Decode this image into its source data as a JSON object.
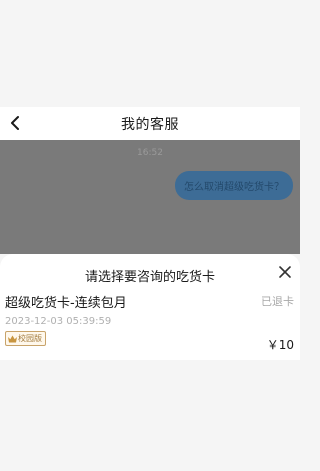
{
  "nav": {
    "title": "我的客服"
  },
  "chat": {
    "time": "16:52",
    "user_message": "怎么取消超级吃货卡？"
  },
  "sheet": {
    "title": "请选择要咨询的吃货卡",
    "card": {
      "name": "超级吃货卡-连续包月",
      "status": "已退卡",
      "time": "2023-12-03 05:39:59",
      "badge": "校园版",
      "price": "￥10"
    }
  },
  "icons": {
    "back": "chevron-left-icon",
    "close": "close-icon",
    "badge": "crown-icon"
  },
  "colors": {
    "overlay": "#7a7a7a",
    "bubble": "#3d6c96",
    "badge_border": "#c8a36a"
  }
}
